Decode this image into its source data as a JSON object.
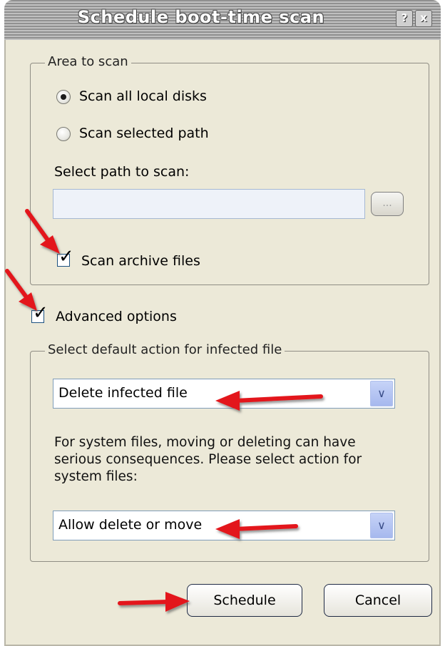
{
  "window": {
    "title": "Schedule boot-time scan",
    "help_glyph": "?",
    "close_glyph": "x"
  },
  "area_to_scan": {
    "legend": "Area to scan",
    "options": [
      {
        "label": "Scan all local disks",
        "selected": true
      },
      {
        "label": "Scan selected path",
        "selected": false
      }
    ],
    "path_label": "Select path to scan:",
    "path_value": "",
    "browse_label": "...",
    "scan_archives_label": "Scan archive files",
    "scan_archives_checked": true
  },
  "advanced": {
    "label": "Advanced options",
    "checked": true
  },
  "default_action": {
    "legend": "Select default action for infected file",
    "action_selected": "Delete infected file",
    "system_files_note": "For system files, moving or deleting can have serious consequences. Please select action for system files:",
    "system_action_selected": "Allow delete or move"
  },
  "buttons": {
    "schedule": "Schedule",
    "cancel": "Cancel"
  },
  "annotations": {
    "arrow_color": "#e3171b"
  }
}
